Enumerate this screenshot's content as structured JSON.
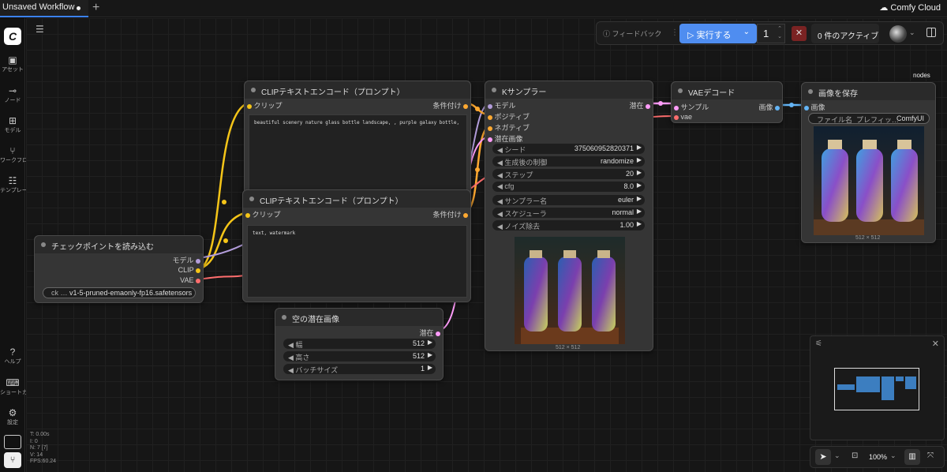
{
  "tab": {
    "title": "Unsaved Workflow",
    "new_tab": "+"
  },
  "cloud": {
    "label": "Comfy Cloud"
  },
  "sidebar": {
    "items": [
      {
        "label": "アセット",
        "icon": "image-icon"
      },
      {
        "label": "ノード",
        "icon": "plug-icon"
      },
      {
        "label": "モデル",
        "icon": "grid-plus-icon"
      },
      {
        "label": "ワークフロー",
        "icon": "workflow-icon"
      },
      {
        "label": "テンプレート",
        "icon": "template-icon"
      },
      {
        "label": "ヘルプ",
        "icon": "help-icon"
      },
      {
        "label": "ショートカット",
        "icon": "keyboard-icon"
      },
      {
        "label": "設定",
        "icon": "gear-icon"
      }
    ]
  },
  "toolbar": {
    "feedback": "フィードバック",
    "run": "実行する",
    "batch_count": "1",
    "active": "0 件のアクティブ",
    "cancel": "✕"
  },
  "canvas_label": "nodes",
  "nodes": {
    "clip_pos": {
      "title": "CLIPテキストエンコード（プロンプト）",
      "in": "クリップ",
      "out": "条件付け",
      "text": "beautiful scenery nature glass bottle landscape, , purple galaxy bottle,"
    },
    "clip_neg": {
      "title": "CLIPテキストエンコード（プロンプト）",
      "in": "クリップ",
      "out": "条件付け",
      "text": "text, watermark"
    },
    "ckpt": {
      "title": "チェックポイントを読み込む",
      "out_model": "モデル",
      "out_clip": "CLIP",
      "out_vae": "VAE",
      "widget_label": "ck …",
      "widget_value": "v1-5-pruned-emaonly-fp16.safetensors"
    },
    "latent": {
      "title": "空の潜在画像",
      "out": "潜在",
      "width_label": "幅",
      "width": "512",
      "height_label": "高さ",
      "height": "512",
      "batch_label": "バッチサイズ",
      "batch": "1"
    },
    "ksampler": {
      "title": "Kサンプラー",
      "in_model": "モデル",
      "in_pos": "ポジティブ",
      "in_neg": "ネガティブ",
      "in_latent": "潜在画像",
      "out": "潜在",
      "widgets": [
        {
          "label": "シード",
          "value": "375060952820371"
        },
        {
          "label": "生成後の制御",
          "value": "randomize"
        },
        {
          "label": "ステップ",
          "value": "20"
        },
        {
          "label": "cfg",
          "value": "8.0"
        },
        {
          "label": "サンプラー名",
          "value": "euler"
        },
        {
          "label": "スケジューラ",
          "value": "normal"
        },
        {
          "label": "ノイズ除去",
          "value": "1.00"
        }
      ],
      "preview_size": "512 × 512"
    },
    "vae": {
      "title": "VAEデコード",
      "in_samples": "サンプル",
      "in_vae": "vae",
      "out": "画像"
    },
    "save": {
      "title": "画像を保存",
      "in": "画像",
      "prefix_label": "ファイル名_プレフィッ…",
      "prefix_value": "ComfyUI",
      "preview_size": "512 × 512"
    }
  },
  "stats": {
    "t": "T: 0.00s",
    "i": "I: 0",
    "n": "N: 7 [7]",
    "v": "V: 14",
    "fps": "FPS:60.24"
  },
  "canvas_controls": {
    "zoom": "100%"
  },
  "colors": {
    "accent": "#4f8df0",
    "clip": "#f5c518",
    "model": "#b39ddb",
    "vae": "#ff6e6e",
    "latent": "#ff9cf9",
    "conditioning": "#ffa931",
    "image": "#64b5f6"
  }
}
